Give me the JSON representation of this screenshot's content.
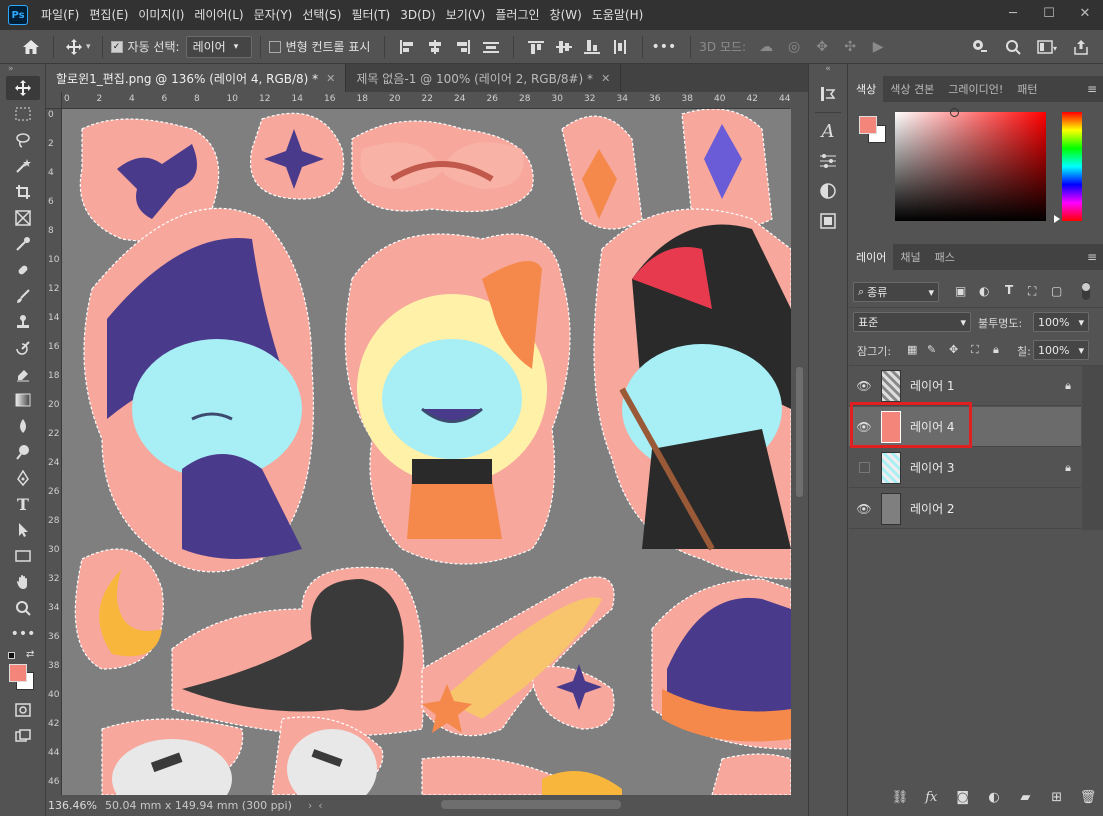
{
  "app": {
    "logo_text": "Ps"
  },
  "menubar": {
    "items": [
      "파일(F)",
      "편집(E)",
      "이미지(I)",
      "레이어(L)",
      "문자(Y)",
      "선택(S)",
      "필터(T)",
      "3D(D)",
      "보기(V)",
      "플러그인",
      "창(W)",
      "도움말(H)"
    ],
    "window_controls": {
      "minimize": "─",
      "maximize": "☐",
      "close": "✕"
    }
  },
  "options_bar": {
    "home_icon": "home-icon",
    "move_tool_icon": "move-icon",
    "auto_select_label": "자동 선택:",
    "auto_select_checked": true,
    "auto_select_target": "레이어",
    "transform_controls_label": "변형 컨트롤 표시",
    "transform_controls_checked": false,
    "more_label": "•••",
    "mode_3d_label": "3D 모드:"
  },
  "tabs": [
    {
      "label": "할로윈1_편집.png @ 136% (레이어 4, RGB/8) *",
      "active": true
    },
    {
      "label": "제목 없음-1 @ 100% (레이어 2, RGB/8#) *",
      "active": false
    }
  ],
  "ruler": {
    "h_ticks": [
      "0",
      "2",
      "4",
      "6",
      "8",
      "10",
      "12",
      "14",
      "16",
      "18",
      "20",
      "22",
      "24",
      "26",
      "28",
      "30",
      "32",
      "34",
      "36",
      "38",
      "40",
      "42",
      "44"
    ],
    "v_ticks": [
      "0",
      "2",
      "4",
      "6",
      "8",
      "10",
      "12",
      "14",
      "16",
      "18",
      "20",
      "22",
      "24",
      "26",
      "28",
      "30",
      "32",
      "34",
      "36",
      "38",
      "40",
      "42",
      "44",
      "46"
    ]
  },
  "status": {
    "zoom": "136.46%",
    "doc_size": "50.04 mm x 149.94 mm (300 ppi)"
  },
  "color_panel": {
    "tabs": [
      "색상",
      "색상 견본",
      "그레이디언!",
      "패턴"
    ],
    "foreground_color": "#f4857b",
    "background_color": "#ffffff",
    "hue_color": "#ff0000"
  },
  "layers_panel": {
    "tabs": [
      "레이어",
      "채널",
      "패스"
    ],
    "filter_label": "종류",
    "blend_mode": "표준",
    "opacity_label": "불투명도:",
    "opacity_value": "100%",
    "lock_label": "잠그기:",
    "fill_label": "칠:",
    "fill_value": "100%",
    "layers": [
      {
        "name": "레이어 1",
        "visible": true,
        "locked": true,
        "selected": false
      },
      {
        "name": "레이어 4",
        "visible": true,
        "locked": false,
        "selected": true
      },
      {
        "name": "레이어 3",
        "visible": false,
        "locked": true,
        "selected": false
      },
      {
        "name": "레이어 2",
        "visible": true,
        "locked": false,
        "selected": false
      }
    ],
    "highlight_color": "#e02020"
  },
  "colors": {
    "canvas_bg": "#7f7f7f",
    "sticker_outline": "#f7a79c",
    "cat_body": "#a8eef5",
    "witch_purple": "#4a3a8c",
    "orange": "#f4894b"
  }
}
